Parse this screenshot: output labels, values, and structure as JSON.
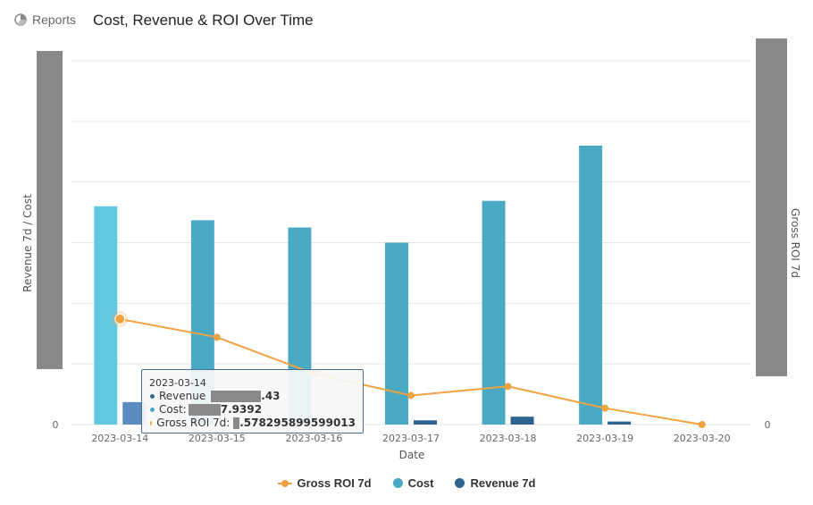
{
  "header": {
    "reports_label": "Reports",
    "title": "Cost, Revenue & ROI Over Time"
  },
  "colors": {
    "cost": "#4aa9c3",
    "cost_highlight": "#62c8df",
    "revenue": "#2f6491",
    "revenue_highlight": "#5b8cbf",
    "roi": "#f0a342",
    "redaction_bar": "#8a8a8a",
    "grid": "#e6e6e6"
  },
  "chart_data": {
    "type": "bar",
    "categories": [
      "2023-03-14",
      "2023-03-15",
      "2023-03-16",
      "2023-03-17",
      "2023-03-18",
      "2023-03-19",
      "2023-03-20"
    ],
    "series": [
      {
        "name": "Cost",
        "type": "bar",
        "axis": "left",
        "values": [
          3.6,
          3.37,
          3.25,
          3.0,
          3.69,
          4.6,
          0
        ]
      },
      {
        "name": "Revenue 7d",
        "type": "bar",
        "axis": "left",
        "values": [
          0.37,
          0,
          0,
          0.07,
          0.13,
          0.05,
          0
        ]
      },
      {
        "name": "Gross ROI 7d",
        "type": "line",
        "axis": "right",
        "values": [
          0.58,
          0.48,
          0.28,
          0.16,
          0.21,
          0.09,
          0
        ]
      }
    ],
    "xlabel": "Date",
    "ylabel_left": "Revenue 7d / Cost",
    "ylabel_right": "Gross ROI 7d",
    "y_left": {
      "tick_label": "0",
      "max": 6
    },
    "y_right": {
      "tick_label": "0",
      "max": 2.0
    },
    "grid": true,
    "legend_position": "bottom",
    "highlighted_index": 0
  },
  "tooltip": {
    "date": "2023-03-14",
    "revenue_label": "Revenue",
    "revenue_value": ".43",
    "cost_label": "Cost:",
    "cost_value": "7.9392",
    "roi_label": "Gross ROI 7d:",
    "roi_value": ".578295899599013"
  },
  "legend": [
    {
      "label": "Gross ROI 7d",
      "icon": "line-marker"
    },
    {
      "label": "Cost",
      "icon": "circle"
    },
    {
      "label": "Revenue 7d",
      "icon": "circle"
    }
  ]
}
